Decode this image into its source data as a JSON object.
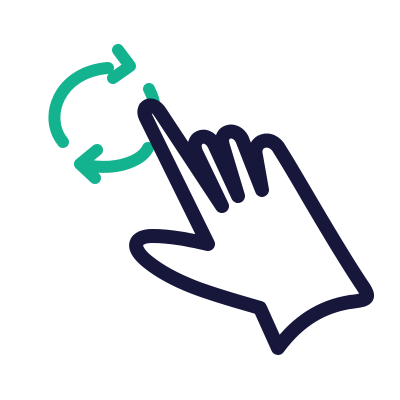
{
  "icon": {
    "name": "rotate-gesture-icon",
    "parts": {
      "rotate_arrows": "refresh-arrows-icon",
      "hand": "pointing-hand-icon"
    }
  },
  "colors": {
    "background": "#ffffff",
    "accent": "#14b38f",
    "stroke": "#16173a"
  }
}
